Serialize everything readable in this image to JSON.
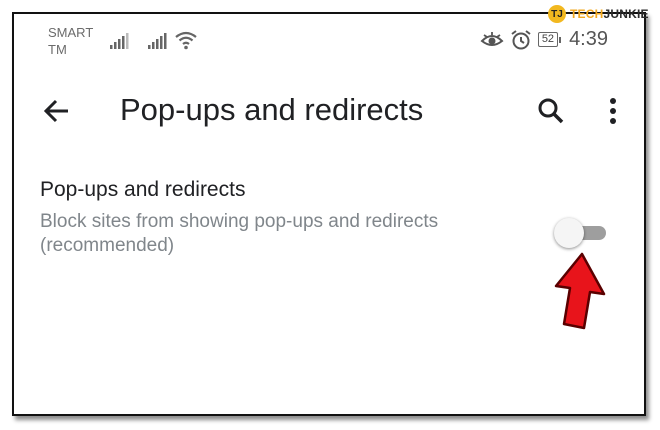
{
  "watermark": {
    "logo": "TJ",
    "brand_part1": "TECH",
    "brand_part2": "JUNKIE"
  },
  "status_bar": {
    "carrier_line1": "SMART",
    "carrier_line2": "TM",
    "battery": "52",
    "time": "4:39"
  },
  "toolbar": {
    "title": "Pop-ups and redirects"
  },
  "setting": {
    "title": "Pop-ups and redirects",
    "description": "Block sites from showing pop-ups and redirects (recommended)",
    "toggle_on": false
  },
  "colors": {
    "arrow": "#e8141b",
    "text_primary": "#202124",
    "text_secondary": "#80868b",
    "toggle_track": "#9e9e9e"
  },
  "icons": [
    "back-arrow-icon",
    "search-icon",
    "more-vert-icon",
    "signal-icon",
    "wifi-icon",
    "eye-icon",
    "alarm-icon",
    "battery-icon",
    "red-pointer-arrow"
  ]
}
